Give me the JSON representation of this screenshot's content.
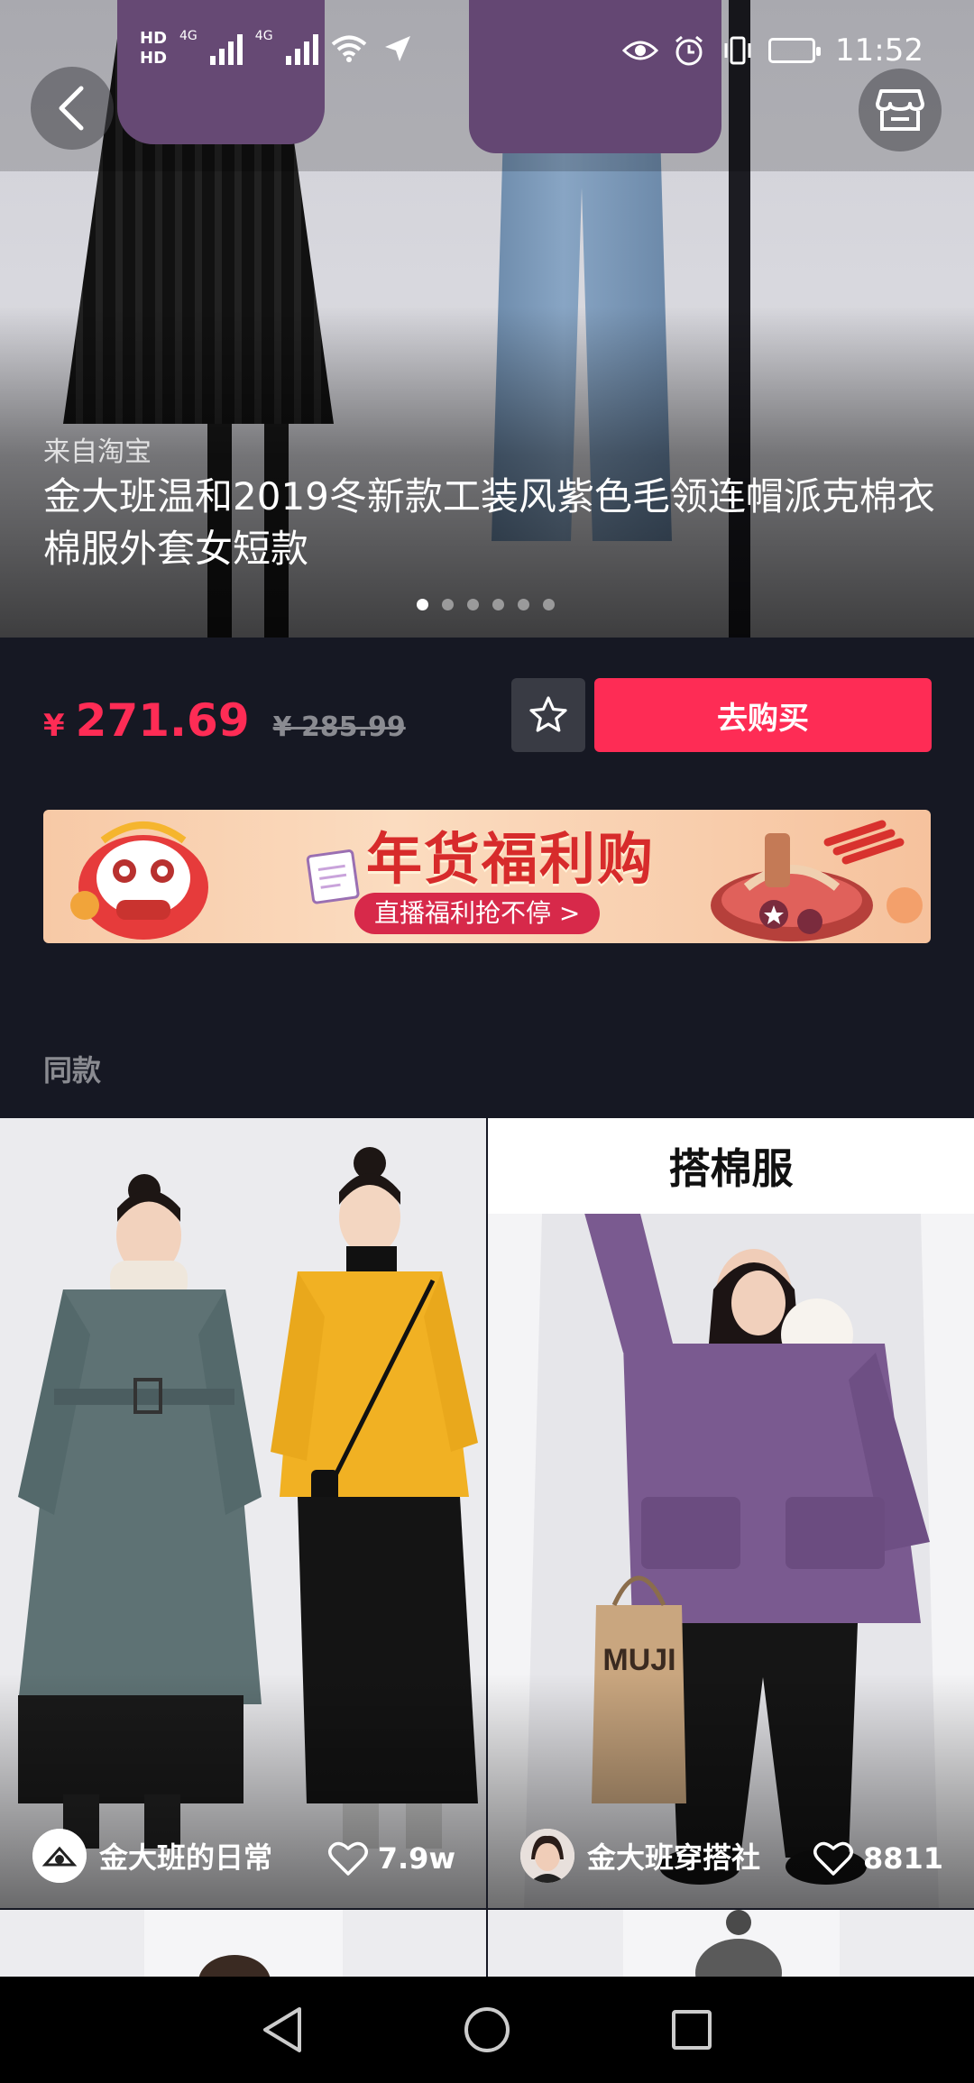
{
  "status_bar": {
    "hd1": "HD",
    "hd2": "HD",
    "net1": "4G",
    "net2": "4G",
    "time": "11:52"
  },
  "product": {
    "source": "来自淘宝",
    "title": "金大班温和2019冬新款工装风紫色毛领连帽派克棉衣棉服外套女短款",
    "carousel_count": 6,
    "carousel_active": 1,
    "price_symbol": "¥",
    "price": "271.69",
    "original_price": "¥ 285.99",
    "buy_label": "去购买"
  },
  "promo": {
    "title": "年货福利购",
    "subtitle": "直播福利抢不停 >"
  },
  "same_items": {
    "label": "同款",
    "cards": [
      {
        "author": "金大班的日常",
        "likes": "7.9w"
      },
      {
        "caption": "搭棉服",
        "photo_text": "MUJI",
        "author": "金大班穿搭社",
        "likes": "8811"
      }
    ]
  },
  "icons": {
    "back": "chevron-left-icon",
    "shop": "store-icon",
    "favorite": "star-outline-icon",
    "like": "heart-outline-icon"
  },
  "colors": {
    "accent": "#fe2c55",
    "background": "#161823",
    "muted": "#8a8b91"
  }
}
